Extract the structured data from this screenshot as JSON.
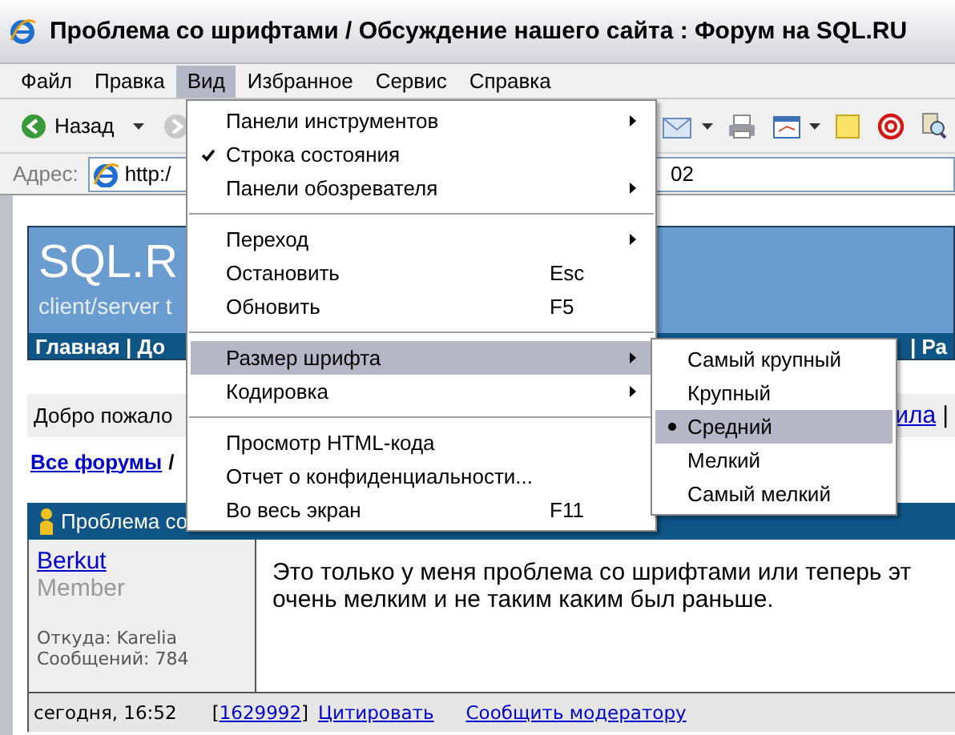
{
  "window": {
    "title": "Проблема со шрифтами / Обсуждение нашего сайта : Форум на SQL.RU"
  },
  "menubar": [
    {
      "label": "Файл",
      "selected": false
    },
    {
      "label": "Правка",
      "selected": false
    },
    {
      "label": "Вид",
      "selected": true
    },
    {
      "label": "Избранное",
      "selected": false
    },
    {
      "label": "Сервис",
      "selected": false
    },
    {
      "label": "Справка",
      "selected": false
    }
  ],
  "toolbar": {
    "back_label": "Назад"
  },
  "address": {
    "label": "Адрес:",
    "value_start": "http:/",
    "value_end": "02"
  },
  "view_menu": [
    {
      "kind": "item",
      "label": "Панели инструментов",
      "checked": false,
      "submenu": true,
      "selected": false
    },
    {
      "kind": "item",
      "label": "Строка состояния",
      "checked": true,
      "submenu": false,
      "selected": false
    },
    {
      "kind": "item",
      "label": "Панели обозревателя",
      "checked": false,
      "submenu": true,
      "selected": false
    },
    {
      "kind": "separator"
    },
    {
      "kind": "item",
      "label": "Переход",
      "checked": false,
      "submenu": true,
      "selected": false
    },
    {
      "kind": "item",
      "label": "Остановить",
      "checked": false,
      "submenu": false,
      "selected": false,
      "shortcut": "Esc"
    },
    {
      "kind": "item",
      "label": "Обновить",
      "checked": false,
      "submenu": false,
      "selected": false,
      "shortcut": "F5"
    },
    {
      "kind": "separator"
    },
    {
      "kind": "item",
      "label": "Размер шрифта",
      "checked": false,
      "submenu": true,
      "selected": true
    },
    {
      "kind": "item",
      "label": "Кодировка",
      "checked": false,
      "submenu": true,
      "selected": false
    },
    {
      "kind": "separator"
    },
    {
      "kind": "item",
      "label": "Просмотр HTML-кода",
      "checked": false,
      "submenu": false,
      "selected": false
    },
    {
      "kind": "item",
      "label": "Отчет о конфиденциальности...",
      "checked": false,
      "submenu": false,
      "selected": false
    },
    {
      "kind": "item",
      "label": "Во весь экран",
      "checked": false,
      "submenu": false,
      "selected": false,
      "shortcut": "F11"
    }
  ],
  "font_size_menu": [
    {
      "label": "Самый крупный",
      "selected": false
    },
    {
      "label": "Крупный",
      "selected": false
    },
    {
      "label": "Средний",
      "selected": true
    },
    {
      "label": "Мелкий",
      "selected": false
    },
    {
      "label": "Самый мелкий",
      "selected": false
    }
  ],
  "page": {
    "banner": {
      "logo": "SQL.R",
      "tagline": "client/server t",
      "nav_left": "Главная | До",
      "nav_right": "| Ра"
    },
    "welcome": {
      "text": "Добро пожало",
      "link": "ила",
      "tail": "|"
    },
    "breadcrumb": {
      "link": "Все форумы",
      "separator": "/"
    },
    "post": {
      "title": "Проблема со",
      "author": "Berkut",
      "role": "Member",
      "from": "Откуда: Karelia",
      "count": "Сообщений: 784",
      "body": [
        "Это только у меня проблема со шрифтами или теперь эт",
        "очень мелким и не таким каким был раньше."
      ],
      "date": "сегодня, 16:52",
      "id_open": "[",
      "id": "1629992",
      "id_close": "]",
      "quote": "Цитировать",
      "report": "Сообщить модератору"
    }
  }
}
